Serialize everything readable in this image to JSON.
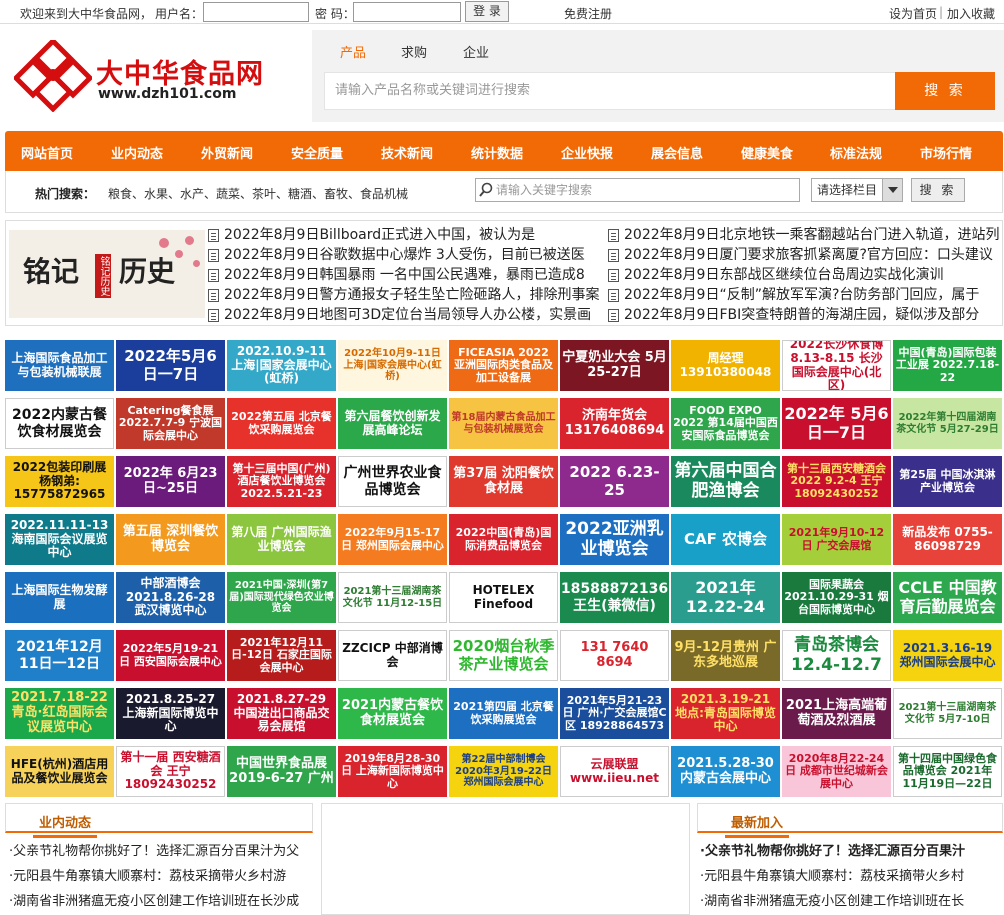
{
  "topbar": {
    "welcome": "欢迎来到大中华食品网，",
    "username_label": "用户名：",
    "password_label": "密 码：",
    "login": "登 录",
    "register": "免费注册",
    "set_home": "设为首页",
    "separator": "|",
    "favorite": "加入收藏"
  },
  "logo": {
    "name": "大中华食品网",
    "url": "www.dzh101.com"
  },
  "search": {
    "tabs": [
      "产品",
      "求购",
      "企业"
    ],
    "active_tab": "产品",
    "placeholder": "请输入产品名称或关键词进行搜索",
    "button": "搜 索"
  },
  "nav": [
    "网站首页",
    "业内动态",
    "外贸新闻",
    "安全质量",
    "技术新闻",
    "统计数据",
    "企业快报",
    "展会信息",
    "健康美食",
    "标准法规",
    "市场行情"
  ],
  "hot": {
    "label": "热门搜索：",
    "words": "粮食、水果、水产、蔬菜、茶叶、糖酒、畜牧、食品机械",
    "keyword_placeholder": "请输入关键字搜索",
    "column_select": "请选择栏目",
    "button": "搜 索"
  },
  "news_image": {
    "left": "铭记",
    "right": "历史",
    "seal": "铭记历史"
  },
  "news_left": [
    "2022年8月9日Billboard正式进入中国，被认为是",
    "2022年8月9日谷歌数据中心爆炸 3人受伤，目前已被送医",
    "2022年8月9日韩国暴雨 一名中国公民遇难，暴雨已造成8",
    "2022年8月9日警方通报女子轻生坠亡险砸路人，排除刑事案",
    "2022年8月9日地图可3D定位台当局领导人办公楼，实景画"
  ],
  "news_right": [
    "2022年8月9日北京地铁一乘客翻越站台门进入轨道，进站列",
    "2022年8月9日厦门要求旅客抓紧离厦?官方回应：口头建议",
    "2022年8月9日东部战区继续位台岛周边实战化演训",
    "2022年8月9日“反制”解放军军演?台防务部门回应，属于",
    "2022年8月9日FBI突查特朗普的海湖庄园，疑似涉及部分"
  ],
  "ads": [
    {
      "t": "上海国际食品加工与包装机械联展",
      "bg": "#1f6fbf",
      "fg": "#ffffff",
      "fs": 12
    },
    {
      "t": "2022年5月6日一7日",
      "bg": "#1b3e9c",
      "fg": "#ffffff",
      "fs": 15
    },
    {
      "t": "2022.10.9-11 上海|国家会展中心(虹桥)",
      "bg": "#33a8c9",
      "fg": "#ffffff",
      "fs": 12
    },
    {
      "t": "2022年10月9-11日 上海|国家会展中心(虹桥)",
      "bg": "#fff6e0",
      "fg": "#d46a00",
      "fs": 10
    },
    {
      "t": "FICEASIA 2022 亚洲国际肉类食品及加工设备展",
      "bg": "#ef6a14",
      "fg": "#ffffff",
      "fs": 11
    },
    {
      "t": "宁夏奶业大会 5月25-27日",
      "bg": "#7b1622",
      "fg": "#ffffff",
      "fs": 13
    },
    {
      "t": "周经理 13910380048",
      "bg": "#f2b200",
      "fg": "#ffffff",
      "fs": 12
    },
    {
      "t": "2022长沙休食博 8.13-8.15 长沙国际会展中心(北区)",
      "bg": "#ffffff",
      "fg": "#c8102e",
      "fs": 12
    },
    {
      "t": "中国(青岛)国际包装工业展 2022.7.18-22",
      "bg": "#24a845",
      "fg": "#ffffff",
      "fs": 11
    },
    {
      "t": "2022内蒙古餐饮食材展览会",
      "bg": "#ffffff",
      "fg": "#111111",
      "fs": 14
    },
    {
      "t": "Catering餐食展 2022.7.7-9 宁波国际会展中心",
      "bg": "#c0392b",
      "fg": "#ffffff",
      "fs": 11
    },
    {
      "t": "2022第五届 北京餐饮采购展览会",
      "bg": "#e6322b",
      "fg": "#ffffff",
      "fs": 11
    },
    {
      "t": "第六届餐饮创新发展高峰论坛",
      "bg": "#2aa84a",
      "fg": "#ffffff",
      "fs": 12
    },
    {
      "t": "第18届内蒙古食品加工与包装机械展览会",
      "bg": "#f6c343",
      "fg": "#c0392b",
      "fs": 10
    },
    {
      "t": "济南年货会 13176408694",
      "bg": "#d9232d",
      "fg": "#ffffff",
      "fs": 13
    },
    {
      "t": "FOOD EXPO 2022 第14届中国西安国际食品博览会",
      "bg": "#2fa64b",
      "fg": "#ffffff",
      "fs": 11
    },
    {
      "t": "2022年 5月6日一7日",
      "bg": "#c8102e",
      "fg": "#ffffff",
      "fs": 16
    },
    {
      "t": "2022年第十四届湖南茶文化节 5月27-29日",
      "bg": "#c7e6a1",
      "fg": "#2e7d32",
      "fs": 10
    },
    {
      "t": "2022包装印刷展 杨钢弟: 15775872965",
      "bg": "#f5c518",
      "fg": "#111111",
      "fs": 12
    },
    {
      "t": "2022年 6月23日~25日",
      "bg": "#6a1b7b",
      "fg": "#ffffff",
      "fs": 13
    },
    {
      "t": "第十三届中国(广州)酒店餐饮业博览会 2022.5.21-23",
      "bg": "#d9232d",
      "fg": "#ffffff",
      "fs": 11
    },
    {
      "t": "广州世界农业食品博览会",
      "bg": "#ffffff",
      "fg": "#111111",
      "fs": 14
    },
    {
      "t": "第37届 沈阳餐饮食材展",
      "bg": "#e03a2e",
      "fg": "#ffffff",
      "fs": 13
    },
    {
      "t": "2022 6.23-25",
      "bg": "#8e2a8e",
      "fg": "#ffffff",
      "fs": 15
    },
    {
      "t": "第六届中国合肥渔博会",
      "bg": "#1a8a5e",
      "fg": "#ffffff",
      "fs": 17
    },
    {
      "t": "第十三届西安糖酒会 2022 9.2-4 王宁 18092430252",
      "bg": "#c8102e",
      "fg": "#ffe066",
      "fs": 11
    },
    {
      "t": "第25届 中国冰淇淋产业博览会",
      "bg": "#3a2f8a",
      "fg": "#ffffff",
      "fs": 11
    },
    {
      "t": "2022.11.11-13 海南国际会议展览中心",
      "bg": "#0f7a8a",
      "fg": "#ffffff",
      "fs": 12
    },
    {
      "t": "第五届 深圳餐饮博览会",
      "bg": "#f39a1e",
      "fg": "#ffffff",
      "fs": 13
    },
    {
      "t": "第八届 广州国际渔业博览会",
      "bg": "#8cc63f",
      "fg": "#ffffff",
      "fs": 12
    },
    {
      "t": "2022年9月15-17日 郑州国际会展中心",
      "bg": "#f47b20",
      "fg": "#ffffff",
      "fs": 11
    },
    {
      "t": "2022中国(青岛)国际消费品博览会",
      "bg": "#d9232d",
      "fg": "#ffffff",
      "fs": 11
    },
    {
      "t": "2022亚洲乳业博览会",
      "bg": "#1d6fc2",
      "fg": "#ffffff",
      "fs": 17
    },
    {
      "t": "CAF 农博会",
      "bg": "#18a0c8",
      "fg": "#ffffff",
      "fs": 15
    },
    {
      "t": "2021年9月10-12日 广交会展馆",
      "bg": "#a4cf3a",
      "fg": "#c8102e",
      "fs": 11
    },
    {
      "t": "新品发布 0755-86098729",
      "bg": "#e8433a",
      "fg": "#ffffff",
      "fs": 12
    },
    {
      "t": "上海国际生物发酵展",
      "bg": "#1a6fbf",
      "fg": "#ffffff",
      "fs": 12
    },
    {
      "t": "中部酒博会 2021.8.26-28 武汉博览中心",
      "bg": "#1d5fa8",
      "fg": "#ffffff",
      "fs": 12
    },
    {
      "t": "2021中国·深圳(第7届)国际现代绿色农业博览会",
      "bg": "#2fa64b",
      "fg": "#ffffff",
      "fs": 10
    },
    {
      "t": "2021第十三届湖南茶文化节 11月12-15日",
      "bg": "#ffffff",
      "fg": "#2e7d32",
      "fs": 10
    },
    {
      "t": "HOTELEX Finefood",
      "bg": "#ffffff",
      "fg": "#111111",
      "fs": 12
    },
    {
      "t": "18588872136 王生(兼微信)",
      "bg": "#1a8a4e",
      "fg": "#ffffff",
      "fs": 14
    },
    {
      "t": "2021年 12.22-24",
      "bg": "#2a9d8f",
      "fg": "#ffffff",
      "fs": 16
    },
    {
      "t": "国际果蔬会 2021.10.29-31 烟台国际博览中心",
      "bg": "#1a7a3e",
      "fg": "#ffffff",
      "fs": 11
    },
    {
      "t": "CCLE 中国教育后勤展览会",
      "bg": "#2ea84f",
      "fg": "#ffffff",
      "fs": 16
    },
    {
      "t": "2021年12月 11日一12日",
      "bg": "#1f7fc8",
      "fg": "#ffffff",
      "fs": 14
    },
    {
      "t": "2022年5月19-21日 西安国际会展中心",
      "bg": "#c8102e",
      "fg": "#ffffff",
      "fs": 11
    },
    {
      "t": "2021年12月11日-12日 石家庄国际会展中心",
      "bg": "#b71c1c",
      "fg": "#ffffff",
      "fs": 11
    },
    {
      "t": "ZZCICP 中部消博会",
      "bg": "#ffffff",
      "fg": "#111111",
      "fs": 12
    },
    {
      "t": "2020烟台秋季茶产业博览会",
      "bg": "#ffffff",
      "fg": "#2eb82e",
      "fs": 15
    },
    {
      "t": "131 7640 8694",
      "bg": "#ffffff",
      "fg": "#d9232d",
      "fs": 13
    },
    {
      "t": "9月-12月贵州 广东多地巡展",
      "bg": "#7a6a2a",
      "fg": "#ffe066",
      "fs": 13
    },
    {
      "t": "青岛茶博会 12.4-12.7",
      "bg": "#ffffff",
      "fg": "#1a8a3e",
      "fs": 17
    },
    {
      "t": "2021.3.16-19 郑州国际会展中心",
      "bg": "#f5d40f",
      "fg": "#1a3e8a",
      "fs": 12
    },
    {
      "t": "2021.7.18-22 青岛·红岛国际会议展览中心",
      "bg": "#1aa84a",
      "fg": "#ffe066",
      "fs": 13
    },
    {
      "t": "2021.8.25-27 上海新国际博览中心",
      "bg": "#1a1a2e",
      "fg": "#ffffff",
      "fs": 12
    },
    {
      "t": "2021.8.27-29 中国进出口商品交易会展馆",
      "bg": "#c8102e",
      "fg": "#ffffff",
      "fs": 12
    },
    {
      "t": "2021内蒙古餐饮食材展览会",
      "bg": "#2eb84a",
      "fg": "#ffffff",
      "fs": 13
    },
    {
      "t": "2021第四届 北京餐饮采购展览会",
      "bg": "#1d6fc2",
      "fg": "#ffffff",
      "fs": 11
    },
    {
      "t": "2021年5月21-23日 广州·广交会展馆C区 18928864573",
      "bg": "#1a4e9c",
      "fg": "#ffffff",
      "fs": 11
    },
    {
      "t": "2021.3.19-21 地点:青岛国际博览中心",
      "bg": "#d9232d",
      "fg": "#ffe066",
      "fs": 12
    },
    {
      "t": "2021上海高端葡萄酒及烈酒展",
      "bg": "#6a1b4b",
      "fg": "#ffffff",
      "fs": 13
    },
    {
      "t": "2021第十三届湖南茶文化节 5月7-10日",
      "bg": "#ffffff",
      "fg": "#2e7d32",
      "fs": 10
    },
    {
      "t": "HFE(杭州)酒店用品及餐饮业展览会",
      "bg": "#f6d25a",
      "fg": "#111111",
      "fs": 12
    },
    {
      "t": "第十一届 西安糖酒会 王宁 18092430252",
      "bg": "#ffffff",
      "fg": "#c8102e",
      "fs": 12
    },
    {
      "t": "中国世界食品展 2019-6-27 广州",
      "bg": "#2fa64b",
      "fg": "#ffffff",
      "fs": 13
    },
    {
      "t": "2019年8月28-30日 上海新国际博览中心",
      "bg": "#d9232d",
      "fg": "#ffffff",
      "fs": 11
    },
    {
      "t": "第22届中部制博会 2020年3月19-22日 郑州国际会展中心",
      "bg": "#f5d40f",
      "fg": "#1a3e8a",
      "fs": 10
    },
    {
      "t": "云展联盟 www.iieu.net",
      "bg": "#ffffff",
      "fg": "#c8102e",
      "fs": 12
    },
    {
      "t": "2021.5.28-30 内蒙古会展中心",
      "bg": "#1d8fd2",
      "fg": "#ffffff",
      "fs": 13
    },
    {
      "t": "2020年8月22-24日 成都市世纪城新会展中心",
      "bg": "#f8c6d8",
      "fg": "#c8102e",
      "fs": 11
    },
    {
      "t": "第十四届中国绿色食品博览会 2021年11月19日—22日",
      "bg": "#ffffff",
      "fg": "#1a6a2e",
      "fs": 11
    }
  ],
  "panel_left": {
    "title": "业内动态",
    "items": [
      "·父亲节礼物帮你挑好了！选择汇源百分百果汁为父",
      "·元阳县牛角寨镇大顺寨村：荔枝采摘带火乡村游",
      "·湖南省非洲猪瘟无疫小区创建工作培训班在长沙成"
    ]
  },
  "panel_right": {
    "title": "最新加入",
    "items": [
      "·父亲节礼物帮你挑好了！选择汇源百分百果汁",
      "·元阳县牛角寨镇大顺寨村：荔枝采摘带火乡村",
      "·湖南省非洲猪瘟无疫小区创建工作培训班在长"
    ]
  },
  "colors": {
    "accent": "#f26a06",
    "logo_red": "#d40e0e"
  }
}
